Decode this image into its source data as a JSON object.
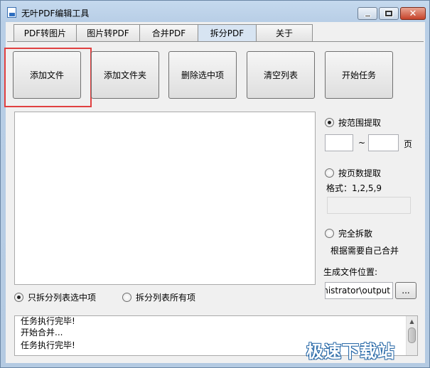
{
  "window": {
    "title": "无叶PDF编辑工具"
  },
  "tabs": [
    {
      "label": "PDF转图片",
      "active": false
    },
    {
      "label": "图片转PDF",
      "active": false
    },
    {
      "label": "合并PDF",
      "active": false
    },
    {
      "label": "拆分PDF",
      "active": true
    },
    {
      "label": "关于",
      "active": false
    }
  ],
  "toolbar": {
    "add_file": "添加文件",
    "add_folder": "添加文件夹",
    "delete_selected": "删除选中项",
    "clear_list": "清空列表",
    "start_task": "开始任务"
  },
  "options": {
    "range_extract": "按范围提取",
    "range_separator": "~",
    "page_unit": "页",
    "page_extract": "按页数提取",
    "format_hint": "格式：1,2,5,9",
    "full_split": "完全拆散",
    "merge_hint": "根据需要自己合并",
    "output_label": "生成文件位置:",
    "output_path": "inistrator\\output",
    "browse_label": "..."
  },
  "scope": {
    "selected_only": "只拆分列表选中项",
    "all_items": "拆分列表所有项"
  },
  "log": [
    "任务执行完毕!",
    "开始合并...",
    "任务执行完毕!"
  ],
  "watermark": "极速下载站"
}
